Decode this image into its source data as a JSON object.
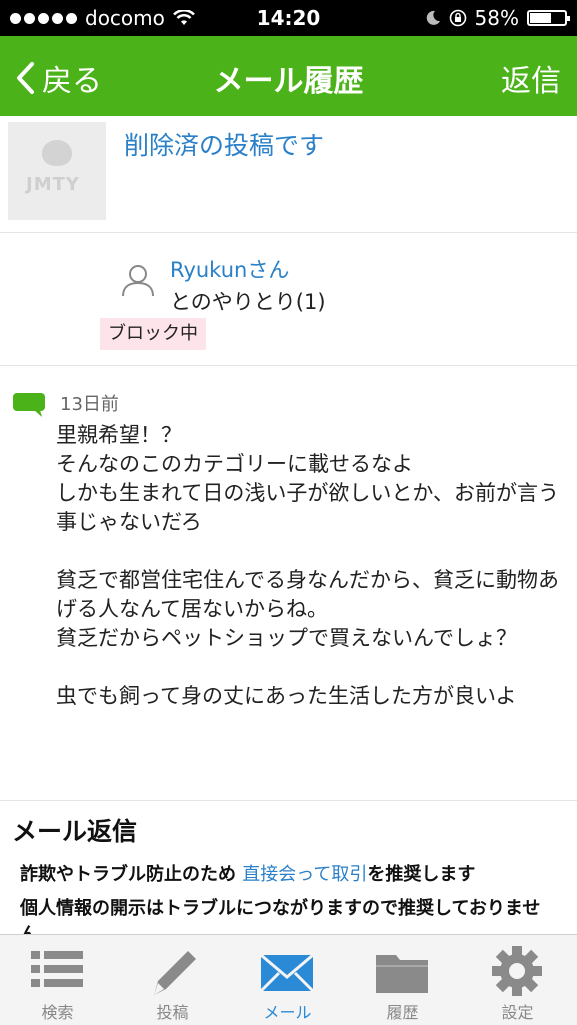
{
  "statusbar": {
    "carrier": "docomo",
    "time": "14:20",
    "battery": "58%"
  },
  "navbar": {
    "back_label": "戻る",
    "title": "メール履歴",
    "reply_label": "返信"
  },
  "post": {
    "thumb_logo": "JMTY",
    "title": "削除済の投稿です"
  },
  "user": {
    "name": "Ryukunさん",
    "subtitle": "とのやりとり(1)",
    "badge": "ブロック中"
  },
  "message": {
    "date": "13日前",
    "body": "里親希望！？\nそんなのこのカテゴリーに載せるなよ\nしかも生まれて日の浅い子が欲しいとか、お前が言う事じゃないだろ\n\n貧乏で都営住宅住んでる身なんだから、貧乏に動物あげる人なんて居ないからね。\n貧乏だからペットショップで買えないんでしょ？\n\n虫でも飼って身の丈にあった生活した方が良いよ"
  },
  "reply_section": {
    "heading": "メール返信",
    "notice_prefix": "詐欺やトラブル防止のため",
    "notice_link": "直接会って取引",
    "notice_suffix": "を推奨します",
    "notice2": "個人情報の開示はトラブルにつながりますので推奨しておりません。"
  },
  "tabs": [
    {
      "label": "検索",
      "icon": "list-icon"
    },
    {
      "label": "投稿",
      "icon": "pencil-icon"
    },
    {
      "label": "メール",
      "icon": "mail-icon",
      "active": true
    },
    {
      "label": "履歴",
      "icon": "folder-icon"
    },
    {
      "label": "設定",
      "icon": "gear-icon"
    }
  ],
  "colors": {
    "navbar": "#4cb219",
    "link": "#2a80c8",
    "active_tab": "#2b8ad6",
    "badge_bg": "#fce4ea"
  }
}
